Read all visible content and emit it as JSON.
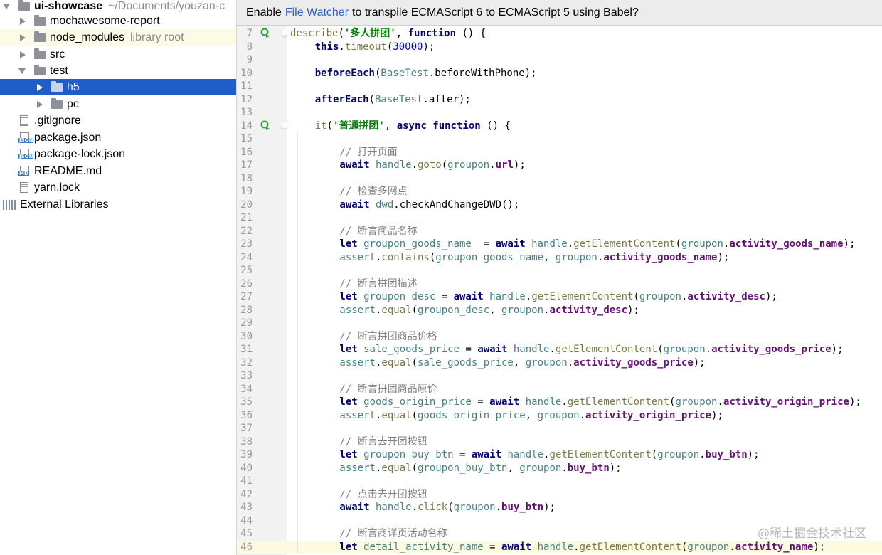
{
  "sidebar": {
    "items": [
      {
        "label": "ui-showcase",
        "extra": "~/Documents/youzan-c",
        "type": "project",
        "expanded": true
      },
      {
        "label": "mochawesome-report",
        "type": "folder"
      },
      {
        "label": "node_modules",
        "extra": "library root",
        "type": "folder"
      },
      {
        "label": "src",
        "type": "folder"
      },
      {
        "label": "test",
        "type": "folder",
        "expanded": true
      },
      {
        "label": "h5",
        "type": "folder",
        "selected": true
      },
      {
        "label": "pc",
        "type": "folder"
      },
      {
        "label": ".gitignore",
        "type": "file"
      },
      {
        "label": "package.json",
        "type": "json"
      },
      {
        "label": "package-lock.json",
        "type": "json"
      },
      {
        "label": "README.md",
        "type": "md"
      },
      {
        "label": "yarn.lock",
        "type": "file"
      },
      {
        "label": "External Libraries",
        "type": "library"
      }
    ]
  },
  "banner": {
    "prefix": "Enable",
    "link": "File Watcher",
    "suffix": "to transpile ECMAScript 6 to ECMAScript 5 using Babel?"
  },
  "editor": {
    "current_line": 46,
    "lines": [
      {
        "n": "7",
        "gutter": "run",
        "fold": true,
        "indent": 0,
        "tokens": [
          [
            "describe",
            "meth"
          ],
          [
            "(",
            ""
          ],
          [
            "'多人拼团'",
            "str"
          ],
          [
            ", ",
            ""
          ],
          [
            "function",
            "kw"
          ],
          [
            " () {",
            ""
          ]
        ]
      },
      {
        "n": "8",
        "indent": 1,
        "tokens": [
          [
            "this",
            "kw"
          ],
          [
            ".",
            ""
          ],
          [
            "timeout",
            "meth"
          ],
          [
            "(",
            ""
          ],
          [
            "30000",
            "num"
          ],
          [
            ");",
            ""
          ]
        ]
      },
      {
        "n": "9",
        "indent": 1,
        "tokens": []
      },
      {
        "n": "10",
        "indent": 1,
        "tokens": [
          [
            "beforeEach",
            "kw"
          ],
          [
            "(",
            ""
          ],
          [
            "BaseTest",
            "obj"
          ],
          [
            ".beforeWithPhone);",
            ""
          ]
        ]
      },
      {
        "n": "11",
        "indent": 1,
        "tokens": []
      },
      {
        "n": "12",
        "indent": 1,
        "tokens": [
          [
            "afterEach",
            "kw"
          ],
          [
            "(",
            ""
          ],
          [
            "BaseTest",
            "obj"
          ],
          [
            ".after);",
            ""
          ]
        ]
      },
      {
        "n": "13",
        "indent": 1,
        "tokens": []
      },
      {
        "n": "14",
        "gutter": "run",
        "fold": true,
        "indent": 1,
        "tokens": [
          [
            "it",
            "meth"
          ],
          [
            "(",
            ""
          ],
          [
            "'普通拼团'",
            "str"
          ],
          [
            ", ",
            ""
          ],
          [
            "async function",
            "kw"
          ],
          [
            " () {",
            ""
          ]
        ]
      },
      {
        "n": "15",
        "indent": 2,
        "tokens": []
      },
      {
        "n": "16",
        "indent": 2,
        "tokens": [
          [
            "// 打开页面",
            "cm"
          ]
        ]
      },
      {
        "n": "17",
        "indent": 2,
        "tokens": [
          [
            "await",
            "kw"
          ],
          [
            " ",
            ""
          ],
          [
            "handle",
            "obj"
          ],
          [
            ".",
            ""
          ],
          [
            "goto",
            "meth"
          ],
          [
            "(",
            ""
          ],
          [
            "groupon",
            "obj"
          ],
          [
            ".",
            ""
          ],
          [
            "url",
            "prop"
          ],
          [
            ");",
            ""
          ]
        ]
      },
      {
        "n": "18",
        "indent": 2,
        "tokens": []
      },
      {
        "n": "19",
        "indent": 2,
        "tokens": [
          [
            "// 检查多网点",
            "cm"
          ]
        ]
      },
      {
        "n": "20",
        "indent": 2,
        "tokens": [
          [
            "await",
            "kw"
          ],
          [
            " ",
            ""
          ],
          [
            "dwd",
            "obj"
          ],
          [
            ".checkAndChangeDWD();",
            ""
          ]
        ]
      },
      {
        "n": "21",
        "indent": 2,
        "tokens": []
      },
      {
        "n": "22",
        "indent": 2,
        "tokens": [
          [
            "// 断言商品名称",
            "cm"
          ]
        ]
      },
      {
        "n": "23",
        "indent": 2,
        "tokens": [
          [
            "let",
            "kw"
          ],
          [
            " ",
            ""
          ],
          [
            "groupon_goods_name",
            "obj"
          ],
          [
            "  = ",
            ""
          ],
          [
            "await",
            "kw"
          ],
          [
            " ",
            ""
          ],
          [
            "handle",
            "obj"
          ],
          [
            ".",
            ""
          ],
          [
            "getElementContent",
            "meth"
          ],
          [
            "(",
            ""
          ],
          [
            "groupon",
            "obj"
          ],
          [
            ".",
            ""
          ],
          [
            "activity_goods_name",
            "prop"
          ],
          [
            ");",
            ""
          ]
        ]
      },
      {
        "n": "24",
        "indent": 2,
        "tokens": [
          [
            "assert",
            "obj"
          ],
          [
            ".",
            ""
          ],
          [
            "contains",
            "meth"
          ],
          [
            "(",
            ""
          ],
          [
            "groupon_goods_name",
            "obj"
          ],
          [
            ", ",
            ""
          ],
          [
            "groupon",
            "obj"
          ],
          [
            ".",
            ""
          ],
          [
            "activity_goods_name",
            "prop"
          ],
          [
            ");",
            ""
          ]
        ]
      },
      {
        "n": "25",
        "indent": 2,
        "tokens": []
      },
      {
        "n": "26",
        "indent": 2,
        "tokens": [
          [
            "// 断言拼团描述",
            "cm"
          ]
        ]
      },
      {
        "n": "27",
        "indent": 2,
        "tokens": [
          [
            "let",
            "kw"
          ],
          [
            " ",
            ""
          ],
          [
            "groupon_desc",
            "obj"
          ],
          [
            " = ",
            ""
          ],
          [
            "await",
            "kw"
          ],
          [
            " ",
            ""
          ],
          [
            "handle",
            "obj"
          ],
          [
            ".",
            ""
          ],
          [
            "getElementContent",
            "meth"
          ],
          [
            "(",
            ""
          ],
          [
            "groupon",
            "obj"
          ],
          [
            ".",
            ""
          ],
          [
            "activity_desc",
            "prop"
          ],
          [
            ");",
            ""
          ]
        ]
      },
      {
        "n": "28",
        "indent": 2,
        "tokens": [
          [
            "assert",
            "obj"
          ],
          [
            ".",
            ""
          ],
          [
            "equal",
            "meth"
          ],
          [
            "(",
            ""
          ],
          [
            "groupon_desc",
            "obj"
          ],
          [
            ", ",
            ""
          ],
          [
            "groupon",
            "obj"
          ],
          [
            ".",
            ""
          ],
          [
            "activity_desc",
            "prop"
          ],
          [
            ");",
            ""
          ]
        ]
      },
      {
        "n": "29",
        "indent": 2,
        "tokens": []
      },
      {
        "n": "30",
        "indent": 2,
        "tokens": [
          [
            "// 断言拼团商品价格",
            "cm"
          ]
        ]
      },
      {
        "n": "31",
        "indent": 2,
        "tokens": [
          [
            "let",
            "kw"
          ],
          [
            " ",
            ""
          ],
          [
            "sale_goods_price",
            "obj"
          ],
          [
            " = ",
            ""
          ],
          [
            "await",
            "kw"
          ],
          [
            " ",
            ""
          ],
          [
            "handle",
            "obj"
          ],
          [
            ".",
            ""
          ],
          [
            "getElementContent",
            "meth"
          ],
          [
            "(",
            ""
          ],
          [
            "groupon",
            "obj"
          ],
          [
            ".",
            ""
          ],
          [
            "activity_goods_price",
            "prop"
          ],
          [
            ");",
            ""
          ]
        ]
      },
      {
        "n": "32",
        "indent": 2,
        "tokens": [
          [
            "assert",
            "obj"
          ],
          [
            ".",
            ""
          ],
          [
            "equal",
            "meth"
          ],
          [
            "(",
            ""
          ],
          [
            "sale_goods_price",
            "obj"
          ],
          [
            ", ",
            ""
          ],
          [
            "groupon",
            "obj"
          ],
          [
            ".",
            ""
          ],
          [
            "activity_goods_price",
            "prop"
          ],
          [
            ");",
            ""
          ]
        ]
      },
      {
        "n": "33",
        "indent": 2,
        "tokens": []
      },
      {
        "n": "34",
        "indent": 2,
        "tokens": [
          [
            "// 断言拼团商品原价",
            "cm"
          ]
        ]
      },
      {
        "n": "35",
        "indent": 2,
        "tokens": [
          [
            "let",
            "kw"
          ],
          [
            " ",
            ""
          ],
          [
            "goods_origin_price",
            "obj"
          ],
          [
            " = ",
            ""
          ],
          [
            "await",
            "kw"
          ],
          [
            " ",
            ""
          ],
          [
            "handle",
            "obj"
          ],
          [
            ".",
            ""
          ],
          [
            "getElementContent",
            "meth"
          ],
          [
            "(",
            ""
          ],
          [
            "groupon",
            "obj"
          ],
          [
            ".",
            ""
          ],
          [
            "activity_origin_price",
            "prop"
          ],
          [
            ");",
            ""
          ]
        ]
      },
      {
        "n": "36",
        "indent": 2,
        "tokens": [
          [
            "assert",
            "obj"
          ],
          [
            ".",
            ""
          ],
          [
            "equal",
            "meth"
          ],
          [
            "(",
            ""
          ],
          [
            "goods_origin_price",
            "obj"
          ],
          [
            ", ",
            ""
          ],
          [
            "groupon",
            "obj"
          ],
          [
            ".",
            ""
          ],
          [
            "activity_origin_price",
            "prop"
          ],
          [
            ");",
            ""
          ]
        ]
      },
      {
        "n": "37",
        "indent": 2,
        "tokens": []
      },
      {
        "n": "38",
        "indent": 2,
        "tokens": [
          [
            "// 断言去开团按钮",
            "cm"
          ]
        ]
      },
      {
        "n": "39",
        "indent": 2,
        "tokens": [
          [
            "let",
            "kw"
          ],
          [
            " ",
            ""
          ],
          [
            "groupon_buy_btn",
            "obj"
          ],
          [
            " = ",
            ""
          ],
          [
            "await",
            "kw"
          ],
          [
            " ",
            ""
          ],
          [
            "handle",
            "obj"
          ],
          [
            ".",
            ""
          ],
          [
            "getElementContent",
            "meth"
          ],
          [
            "(",
            ""
          ],
          [
            "groupon",
            "obj"
          ],
          [
            ".",
            ""
          ],
          [
            "buy_btn",
            "prop"
          ],
          [
            ");",
            ""
          ]
        ]
      },
      {
        "n": "40",
        "indent": 2,
        "tokens": [
          [
            "assert",
            "obj"
          ],
          [
            ".",
            ""
          ],
          [
            "equal",
            "meth"
          ],
          [
            "(",
            ""
          ],
          [
            "groupon_buy_btn",
            "obj"
          ],
          [
            ", ",
            ""
          ],
          [
            "groupon",
            "obj"
          ],
          [
            ".",
            ""
          ],
          [
            "buy_btn",
            "prop"
          ],
          [
            ");",
            ""
          ]
        ]
      },
      {
        "n": "41",
        "indent": 2,
        "tokens": []
      },
      {
        "n": "42",
        "indent": 2,
        "tokens": [
          [
            "// 点击去开团按钮",
            "cm"
          ]
        ]
      },
      {
        "n": "43",
        "indent": 2,
        "tokens": [
          [
            "await",
            "kw"
          ],
          [
            " ",
            ""
          ],
          [
            "handle",
            "obj"
          ],
          [
            ".",
            ""
          ],
          [
            "click",
            "meth"
          ],
          [
            "(",
            ""
          ],
          [
            "groupon",
            "obj"
          ],
          [
            ".",
            ""
          ],
          [
            "buy_btn",
            "prop"
          ],
          [
            ");",
            ""
          ]
        ]
      },
      {
        "n": "44",
        "indent": 2,
        "tokens": []
      },
      {
        "n": "45",
        "indent": 2,
        "tokens": [
          [
            "// 断言商详页活动名称",
            "cm"
          ]
        ]
      },
      {
        "n": "46",
        "indent": 2,
        "tokens": [
          [
            "let",
            "kw"
          ],
          [
            " ",
            ""
          ],
          [
            "detail_activity_name",
            "obj"
          ],
          [
            " = ",
            ""
          ],
          [
            "await",
            "kw"
          ],
          [
            " ",
            ""
          ],
          [
            "handle",
            "obj"
          ],
          [
            ".",
            ""
          ],
          [
            "getElementContent",
            "meth"
          ],
          [
            "(",
            ""
          ],
          [
            "groupon",
            "obj"
          ],
          [
            ".",
            ""
          ],
          [
            "activity_name",
            "prop"
          ],
          [
            ");",
            ""
          ]
        ]
      }
    ]
  },
  "watermark": "@稀土掘金技术社区",
  "colors": {
    "selection": "#1f5dc9",
    "link": "#2e5fd1",
    "keyword": "#000080",
    "string": "#008000",
    "comment": "#808080",
    "property": "#660e7a"
  },
  "icons": {
    "run": "run-gutter-icon",
    "fold": "fold-marker-icon",
    "folder": "folder-icon",
    "file": "file-icon",
    "json": "json-file-icon",
    "md": "markdown-file-icon",
    "library": "library-icon"
  }
}
